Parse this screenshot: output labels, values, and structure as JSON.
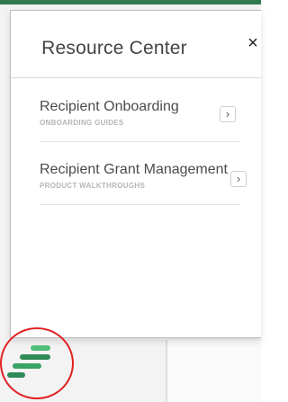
{
  "resource_center": {
    "title": "Resource Center",
    "close_label": "×",
    "items": [
      {
        "title": "Recipient Onboarding",
        "subtitle": "ONBOARDING GUIDES",
        "chevron": "›"
      },
      {
        "title": "Recipient Grant Management",
        "subtitle": "PRODUCT WALKTHROUGHS",
        "chevron": "›"
      }
    ]
  },
  "colors": {
    "brand_green": "#2f7a4f",
    "launcher_green_dark": "#2e8b57",
    "launcher_green_light": "#4fbf7a",
    "annotation_red": "#e02020"
  },
  "icons": {
    "launcher": "resource-center-launcher-icon",
    "close": "close-icon",
    "chevron": "chevron-right-icon"
  }
}
